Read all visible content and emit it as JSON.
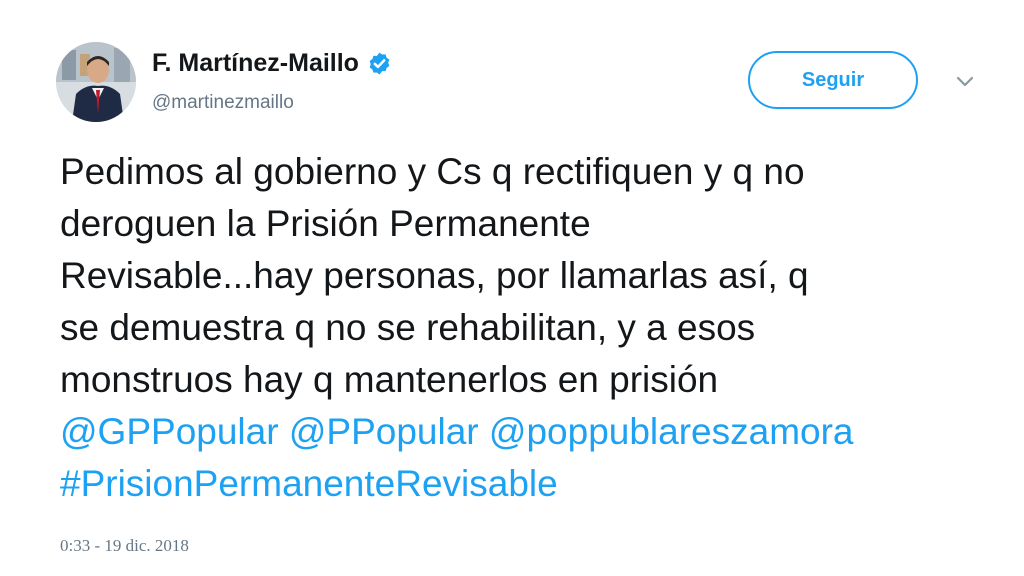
{
  "author": {
    "name": "F. Martínez-Maillo",
    "handle": "@martinezmaillo",
    "verified_icon": "verified-badge-icon",
    "avatar_icon": "avatar"
  },
  "actions": {
    "follow_label": "Seguir",
    "more_icon": "chevron-down-icon"
  },
  "tweet": {
    "lines": [
      "Pedimos al gobierno y Cs q rectifiquen y q no",
      "deroguen la Prisión Permanente",
      "Revisable...hay personas, por llamarlas así, q",
      "se demuestra q no se rehabilitan, y a esos",
      "monstruos hay q mantenerlos en prisión"
    ],
    "mentions": [
      "@GPPopular",
      "@PPopular",
      "@poppublareszamora"
    ],
    "hashtag": "#PrisionPermanenteRevisable"
  },
  "meta": {
    "timestamp": "0:33 - 19 dic. 2018"
  },
  "colors": {
    "link": "#1da1f2",
    "text": "#14171a",
    "secondary": "#657786",
    "verified": "#1da1f2"
  }
}
